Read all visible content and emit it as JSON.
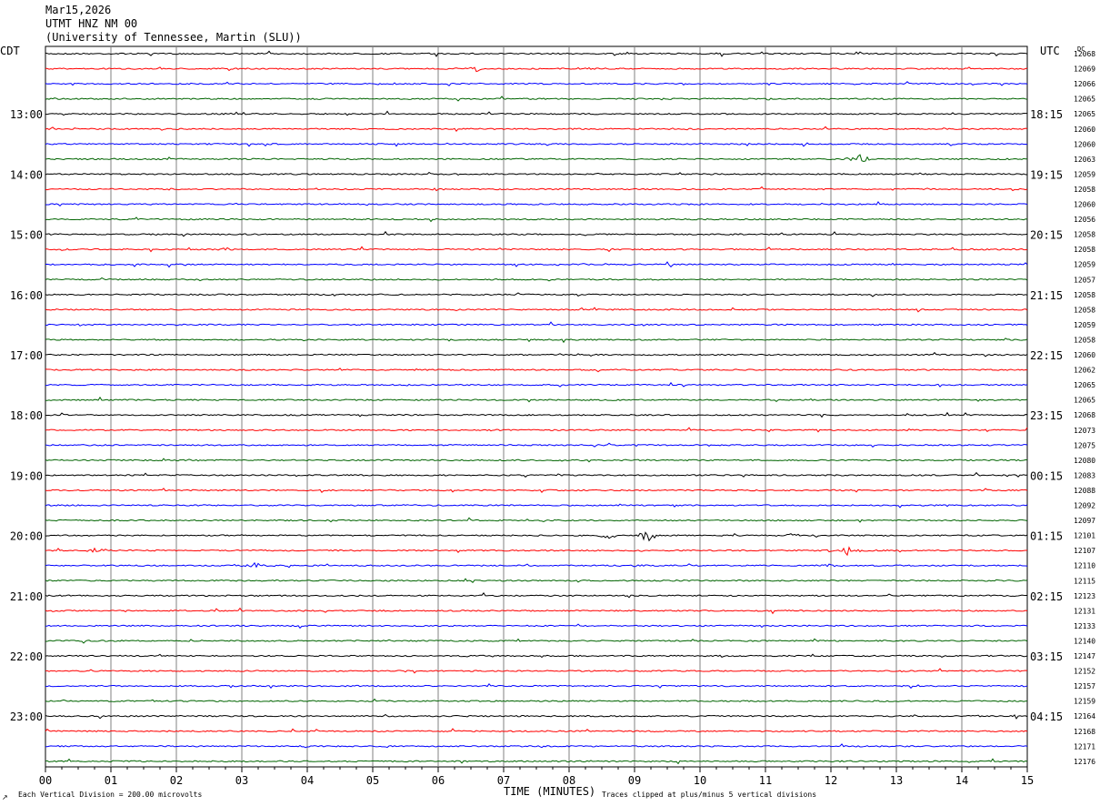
{
  "header": {
    "date": "Mar15,2026",
    "station": "UTMT HNZ NM 00",
    "network": "(University of Tennessee, Martin (SLU))"
  },
  "left_label": "CDT",
  "right_label": "UTC",
  "dc_label": "DC",
  "footer": {
    "scale_note": "Each Vertical Division =  200.00 microvolts",
    "clip_note": "Traces clipped at plus/minus 5 vertical divisions",
    "corner_mark": "↗"
  },
  "colors": {
    "black": "#000000",
    "red": "#ff0000",
    "blue": "#0000ff",
    "green": "#006400",
    "grid": "#808080"
  },
  "chart_data": {
    "type": "line",
    "title": "UTMT HNZ NM 00",
    "xlabel": "TIME (MINUTES)",
    "ylabel": "",
    "xlim": [
      0,
      15
    ],
    "x_ticks": [
      "00",
      "01",
      "02",
      "03",
      "04",
      "05",
      "06",
      "07",
      "08",
      "09",
      "10",
      "11",
      "12",
      "13",
      "14",
      "15"
    ],
    "trace_color_cycle": [
      "black",
      "red",
      "blue",
      "green"
    ],
    "left_hour_labels": [
      "13:00",
      "14:00",
      "15:00",
      "16:00",
      "17:00",
      "18:00",
      "19:00",
      "20:00",
      "21:00",
      "22:00",
      "23:00"
    ],
    "right_hour_labels": [
      "18:15",
      "19:15",
      "20:15",
      "21:15",
      "22:15",
      "23:15",
      "00:15",
      "01:15",
      "02:15",
      "03:15",
      "04:15"
    ],
    "dc_values": [
      "12068",
      "12069",
      "12066",
      "12065",
      "12065",
      "12060",
      "12060",
      "12063",
      "12059",
      "12058",
      "12060",
      "12056",
      "12058",
      "12058",
      "12059",
      "12057",
      "12058",
      "12058",
      "12059",
      "12058",
      "12060",
      "12062",
      "12065",
      "12065",
      "12068",
      "12073",
      "12075",
      "12080",
      "12083",
      "12088",
      "12092",
      "12097",
      "12101",
      "12107",
      "12110",
      "12115",
      "12123",
      "12131",
      "12133",
      "12140",
      "12147",
      "12152",
      "12157",
      "12159",
      "12164",
      "12168",
      "12171",
      "12176"
    ],
    "events": [
      {
        "trace": 1,
        "minute": 6.55,
        "amp": 5
      },
      {
        "trace": 1,
        "minute": 8.3,
        "amp": 2
      },
      {
        "trace": 2,
        "minute": 5.2,
        "amp": 1.5
      },
      {
        "trace": 4,
        "minute": 3.0,
        "amp": 1.5
      },
      {
        "trace": 7,
        "minute": 12.45,
        "amp": 9
      },
      {
        "trace": 9,
        "minute": 2.0,
        "amp": 1.2
      },
      {
        "trace": 9,
        "minute": 6.0,
        "amp": 2
      },
      {
        "trace": 13,
        "minute": 2.8,
        "amp": 2
      },
      {
        "trace": 27,
        "minute": 2.3,
        "amp": 1.5
      },
      {
        "trace": 32,
        "minute": 9.2,
        "amp": 9
      },
      {
        "trace": 32,
        "minute": 8.6,
        "amp": 3
      },
      {
        "trace": 32,
        "minute": 11.4,
        "amp": 2.5
      },
      {
        "trace": 33,
        "minute": 0.75,
        "amp": 3
      },
      {
        "trace": 33,
        "minute": 12.3,
        "amp": 4
      },
      {
        "trace": 34,
        "minute": 3.2,
        "amp": 3
      },
      {
        "trace": 34,
        "minute": 12.0,
        "amp": 2
      },
      {
        "trace": 34,
        "minute": 9.0,
        "amp": 1.5
      }
    ]
  }
}
